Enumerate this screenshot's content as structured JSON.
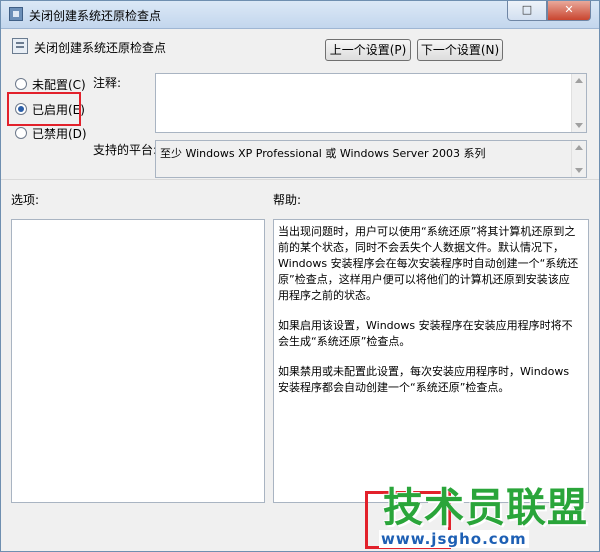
{
  "window": {
    "title": "关闭创建系统还原检查点",
    "maximize_glyph": "□",
    "close_glyph": "✕"
  },
  "header": {
    "policy_name": "关闭创建系统还原检查点",
    "prev_button": "上一个设置(P)",
    "next_button": "下一个设置(N)"
  },
  "state": {
    "options": [
      {
        "label": "未配置(C)",
        "selected": false
      },
      {
        "label": "已启用(E)",
        "selected": true
      },
      {
        "label": "已禁用(D)",
        "selected": false
      }
    ],
    "highlight_color": "#e2212b"
  },
  "comment": {
    "label": "注释:",
    "value": ""
  },
  "platform": {
    "label": "支持的平台:",
    "value": "至少 Windows XP Professional 或 Windows Server 2003 系列"
  },
  "options_panel": {
    "label": "选项:"
  },
  "help_panel": {
    "label": "帮助:",
    "paragraphs": [
      "当出现问题时，用户可以使用“系统还原”将其计算机还原到之前的某个状态，同时不会丢失个人数据文件。默认情况下，Windows 安装程序会在每次安装程序时自动创建一个“系统还原”检查点，这样用户便可以将他们的计算机还原到安装该应用程序之前的状态。",
      "如果启用该设置，Windows 安装程序在安装应用程序时将不会生成“系统还原”检查点。",
      "如果禁用或未配置此设置，每次安装应用程序时，Windows 安装程序都会自动创建一个“系统还原”检查点。"
    ]
  },
  "watermark": {
    "text": "技术员联盟",
    "url": "www.jsgho.com",
    "color": "#2aa53a"
  }
}
